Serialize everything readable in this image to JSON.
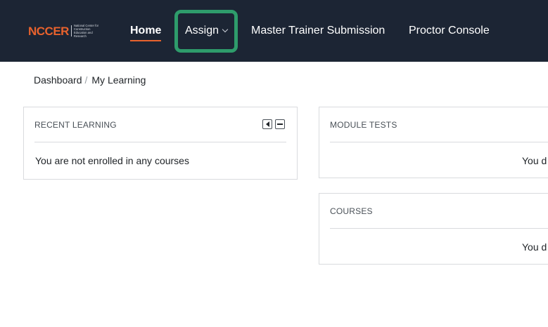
{
  "nav": {
    "logo": {
      "wordmark": "NCCER",
      "tagline": "National Center for Construction Education and Research"
    },
    "items": [
      {
        "label": "Home",
        "active": true
      },
      {
        "label": "Assign",
        "has_dropdown": true
      },
      {
        "label": "Master Trainer Submission"
      },
      {
        "label": "Proctor Console"
      }
    ],
    "colors": {
      "bar": "#1c2534",
      "accent": "#e8622d",
      "highlight": "#2e9c6b"
    }
  },
  "breadcrumb": {
    "items": [
      "Dashboard",
      "My Learning"
    ],
    "separator": "/"
  },
  "cards": {
    "recent_learning": {
      "title": "RECENT LEARNING",
      "body": "You are not enrolled in any courses",
      "controls": [
        "collapse-icon",
        "minimize-icon"
      ]
    },
    "module_tests": {
      "title": "MODULE TESTS",
      "body": "You d"
    },
    "courses": {
      "title": "COURSES",
      "body": "You d"
    }
  }
}
